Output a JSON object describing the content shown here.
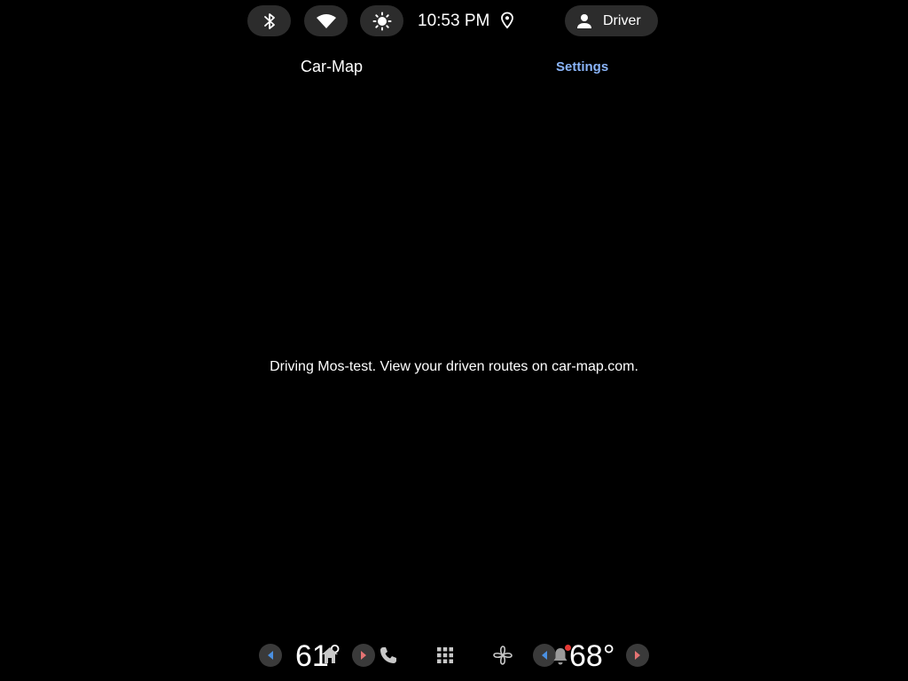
{
  "status_bar": {
    "icons": [
      "bluetooth-icon",
      "wifi-icon",
      "brightness-icon",
      "location-icon",
      "person-icon"
    ],
    "time": "10:53 PM",
    "user_label": "Driver"
  },
  "header": {
    "app_title": "Car-Map",
    "settings_label": "Settings"
  },
  "main": {
    "message": "Driving Mos-test. View your driven routes on car-map.com."
  },
  "bottom_bar": {
    "driver_temp": "61°",
    "passenger_temp": "68°",
    "icons": [
      "home-icon",
      "phone-icon",
      "apps-grid-icon",
      "fan-icon",
      "notification-bell-icon"
    ],
    "notification_badge": true
  },
  "colors": {
    "background": "#000000",
    "pill": "#2c2c2c",
    "accent_link": "#8ab4f8",
    "arrow_left": "#4a90e2",
    "arrow_right": "#e57373",
    "badge": "#e53935"
  }
}
